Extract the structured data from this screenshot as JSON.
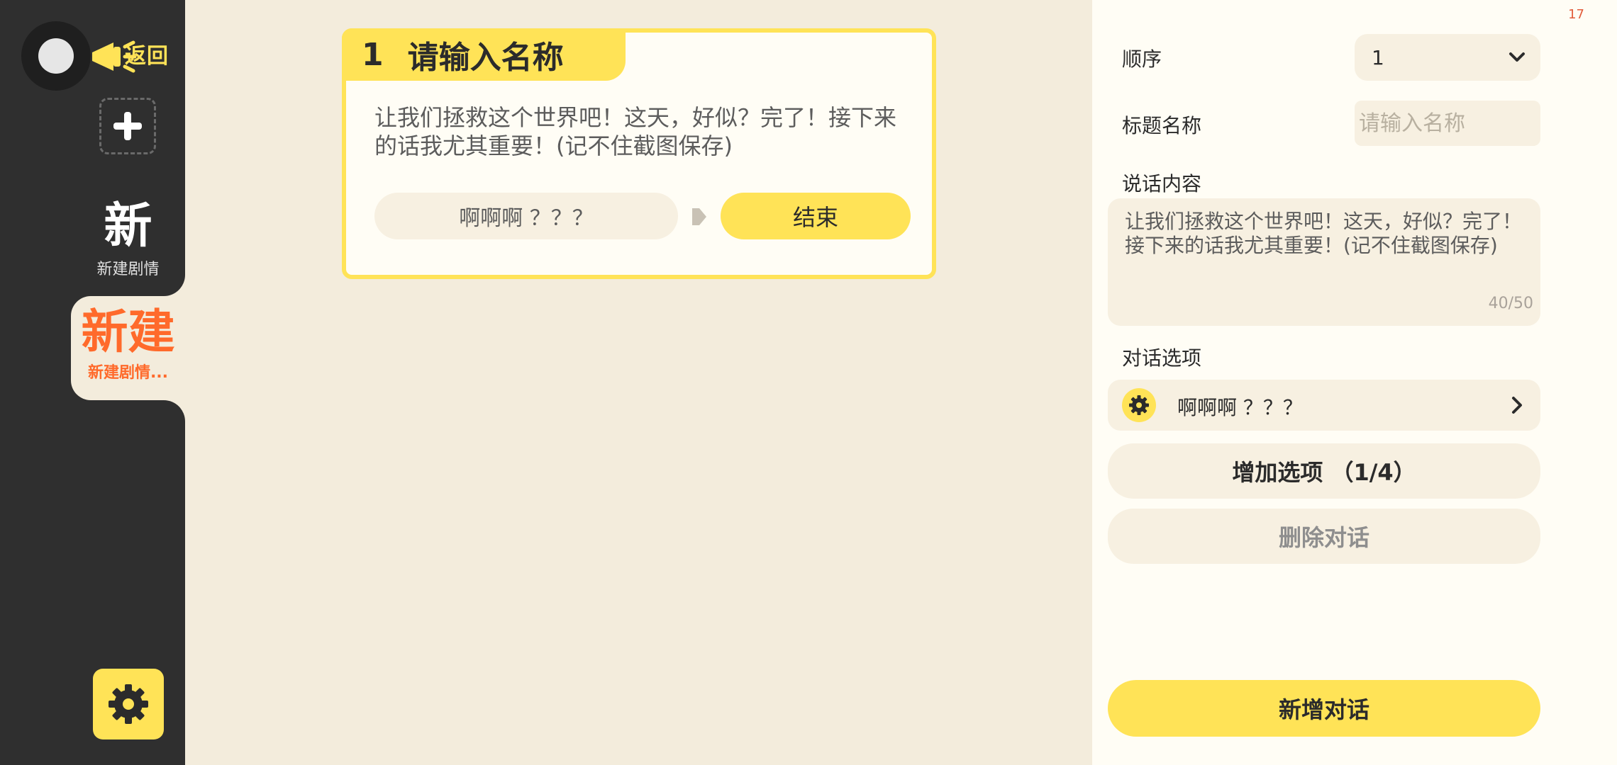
{
  "sidebar": {
    "back_label": "返回",
    "stories": [
      {
        "big": "新",
        "small": "新建剧情"
      },
      {
        "big": "新建",
        "small": "新建剧情..."
      }
    ]
  },
  "card": {
    "index": "1",
    "title": "请输入名称",
    "text": "让我们拯救这个世界吧！这天，好似？完了！接下来的话我尤其重要！(记不住截图保存)",
    "option_label": "啊啊啊 ？？？",
    "end_label": "结束"
  },
  "panel": {
    "corner_number": "17",
    "order_label": "顺序",
    "order_value": "1",
    "title_label": "标题名称",
    "title_placeholder": "请输入名称",
    "content_label": "说话内容",
    "content_value": "让我们拯救这个世界吧！这天，好似？完了！接下来的话我尤其重要！(记不住截图保存)",
    "content_count": "40/50",
    "options_label": "对话选项",
    "option_item": "啊啊啊 ？？？",
    "add_option_label": "增加选项 （1/4）",
    "delete_label": "删除对话",
    "new_dialog_label": "新增对话"
  },
  "colors": {
    "accent_yellow": "#ffe357",
    "sidebar_dark": "#2f2f2f",
    "accent_orange": "#ff6a2b",
    "background": "#f3ecdc"
  }
}
